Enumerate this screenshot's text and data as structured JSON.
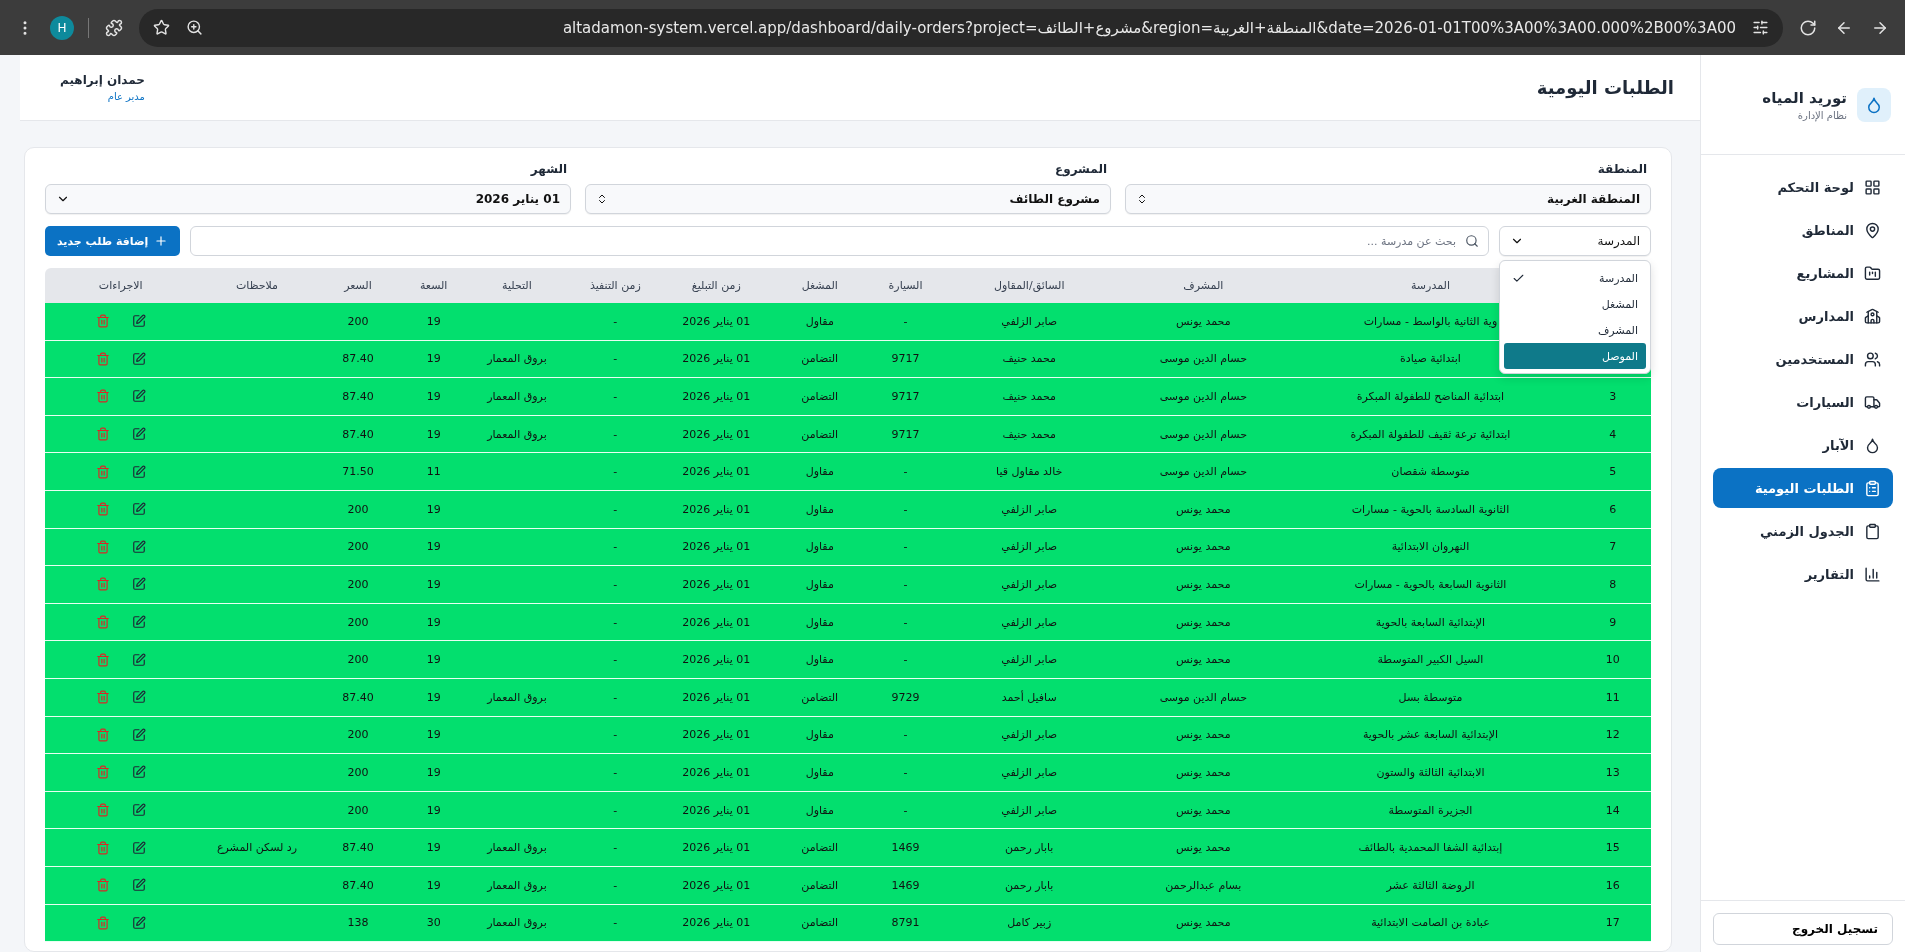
{
  "browser": {
    "profile_initial": "H",
    "url": "altadamon-system.vercel.app/dashboard/daily-orders?project=مشروع+الطائف&region=المنطقة+الغربية&date=2026-01-01T00%3A00%3A00.000%2B00%3A00"
  },
  "header": {
    "title": "الطلبات اليومية",
    "user_name": "حمدان إبراهيم",
    "user_role": "مدير عام"
  },
  "sidebar": {
    "brand": "توريد المياه",
    "subtitle": "نظام الإدارة",
    "items": [
      {
        "label": "لوحة التحكم",
        "selected": false
      },
      {
        "label": "المناطق",
        "selected": false
      },
      {
        "label": "المشاريع",
        "selected": false
      },
      {
        "label": "المدارس",
        "selected": false
      },
      {
        "label": "المستخدمين",
        "selected": false
      },
      {
        "label": "السيارات",
        "selected": false
      },
      {
        "label": "الآبار",
        "selected": false
      },
      {
        "label": "الطلبات اليومية",
        "selected": true
      },
      {
        "label": "الجدول الزمني",
        "selected": false
      },
      {
        "label": "التقارير",
        "selected": false
      }
    ],
    "logout": "تسجيل الخروج"
  },
  "filters": [
    {
      "label": "المنطقة",
      "value": "المنطقة الغربية",
      "kind": "updown"
    },
    {
      "label": "المشروع",
      "value": "مشروع الطائف",
      "kind": "updown"
    },
    {
      "label": "الشهر",
      "value": "01 يناير 2026",
      "kind": "down"
    }
  ],
  "search_by": {
    "value": "المدرسة",
    "options": [
      {
        "label": "المدرسة",
        "selected": true,
        "highlighted": false
      },
      {
        "label": "المشغل",
        "selected": false,
        "highlighted": false
      },
      {
        "label": "المشرف",
        "selected": false,
        "highlighted": false
      },
      {
        "label": "الموصل",
        "selected": false,
        "highlighted": true
      }
    ]
  },
  "search": {
    "placeholder": "بحث عن مدرسة ..."
  },
  "add_button": "إضافة طلب جديد",
  "table": {
    "columns": [
      "المدرسة",
      "المشرف",
      "السائق/المقاول",
      "السيارة",
      "المشغل",
      "زمن التبليغ",
      "زمن التنفيذ",
      "التحلية",
      "السعة",
      "السعر",
      "ملاحظات",
      "الاجراءات"
    ],
    "rows": [
      {
        "school": "وية الثانية بالواسط - مسارات",
        "supervisor": "محمد يونس",
        "driver": "صابر الزلفي",
        "car": "-",
        "operator": "مقاول",
        "reported": "01 يناير 2026",
        "executed": "-",
        "capacity": "19",
        "price": "200"
      },
      {
        "school": "ابتدائية صيادة",
        "supervisor": "حسام الدين موسى",
        "driver": "محمد حنيف",
        "car": "9717",
        "operator": "التضامن",
        "reported": "01 يناير 2026",
        "executed": "-",
        "desalination": "بروق المعمار",
        "capacity": "19",
        "price": "87.40"
      },
      {
        "num": "3",
        "school": "ابتدائية المناضح للطفولة المبكرة",
        "supervisor": "حسام الدين موسى",
        "driver": "محمد حنيف",
        "car": "9717",
        "operator": "التضامن",
        "reported": "01 يناير 2026",
        "executed": "-",
        "desalination": "بروق المعمار",
        "capacity": "19",
        "price": "87.40"
      },
      {
        "num": "4",
        "school": "ابتدائية ترعة ثقيف للطفولة المبكرة",
        "supervisor": "حسام الدين موسى",
        "driver": "محمد حنيف",
        "car": "9717",
        "operator": "التضامن",
        "reported": "01 يناير 2026",
        "executed": "-",
        "desalination": "بروق المعمار",
        "capacity": "19",
        "price": "87.40"
      },
      {
        "num": "5",
        "school": "متوسطة شقصان",
        "supervisor": "حسام الدين موسى",
        "driver": "خالد مقاول قيا",
        "car": "-",
        "operator": "مقاول",
        "reported": "01 يناير 2026",
        "executed": "-",
        "capacity": "11",
        "price": "71.50"
      },
      {
        "num": "6",
        "school": "الثانوية السادسة بالحوية - مسارات",
        "supervisor": "محمد يونس",
        "driver": "صابر الزلفي",
        "car": "-",
        "operator": "مقاول",
        "reported": "01 يناير 2026",
        "executed": "-",
        "capacity": "19",
        "price": "200"
      },
      {
        "num": "7",
        "school": "النهروان الابتدائية",
        "supervisor": "محمد يونس",
        "driver": "صابر الزلفي",
        "car": "-",
        "operator": "مقاول",
        "reported": "01 يناير 2026",
        "executed": "-",
        "capacity": "19",
        "price": "200"
      },
      {
        "num": "8",
        "school": "الثانوية السابعة بالحوية - مسارات",
        "supervisor": "محمد يونس",
        "driver": "صابر الزلفي",
        "car": "-",
        "operator": "مقاول",
        "reported": "01 يناير 2026",
        "executed": "-",
        "capacity": "19",
        "price": "200"
      },
      {
        "num": "9",
        "school": "الإبتدائية السابعة بالحوية",
        "supervisor": "محمد يونس",
        "driver": "صابر الزلفي",
        "car": "-",
        "operator": "مقاول",
        "reported": "01 يناير 2026",
        "executed": "-",
        "capacity": "19",
        "price": "200"
      },
      {
        "num": "10",
        "school": "السيل الكبير المتوسطة",
        "supervisor": "محمد يونس",
        "driver": "صابر الزلفي",
        "car": "-",
        "operator": "مقاول",
        "reported": "01 يناير 2026",
        "executed": "-",
        "capacity": "19",
        "price": "200"
      },
      {
        "num": "11",
        "school": "متوسطة بسل",
        "supervisor": "حسام الدين موسى",
        "driver": "سافيل أحمد",
        "car": "9729",
        "operator": "التضامن",
        "reported": "01 يناير 2026",
        "executed": "-",
        "desalination": "بروق المعمار",
        "capacity": "19",
        "price": "87.40"
      },
      {
        "num": "12",
        "school": "الإبتدائية السابعة عشر بالحوية",
        "supervisor": "محمد يونس",
        "driver": "صابر الزلفي",
        "car": "-",
        "operator": "مقاول",
        "reported": "01 يناير 2026",
        "executed": "-",
        "capacity": "19",
        "price": "200"
      },
      {
        "num": "13",
        "school": "الابتدائية الثالثة والستون",
        "supervisor": "محمد يونس",
        "driver": "صابر الزلفي",
        "car": "-",
        "operator": "مقاول",
        "reported": "01 يناير 2026",
        "executed": "-",
        "capacity": "19",
        "price": "200"
      },
      {
        "num": "14",
        "school": "الجزيرة المتوسطة",
        "supervisor": "محمد يونس",
        "driver": "صابر الزلفي",
        "car": "-",
        "operator": "مقاول",
        "reported": "01 يناير 2026",
        "executed": "-",
        "capacity": "19",
        "price": "200"
      },
      {
        "num": "15",
        "school": "إبتدائية الشفا المحمدية بالطائف",
        "supervisor": "محمد يونس",
        "driver": "بابار رحمن",
        "car": "1469",
        "operator": "التضامن",
        "reported": "01 يناير 2026",
        "executed": "-",
        "desalination": "بروق المعمار",
        "capacity": "19",
        "price": "87.40",
        "notes": "رد لسكن المشرع"
      },
      {
        "num": "16",
        "school": "الروضة الثالثة عشر",
        "supervisor": "بسام عبدالرحمن",
        "driver": "بابار رحمن",
        "car": "1469",
        "operator": "التضامن",
        "reported": "01 يناير 2026",
        "executed": "-",
        "desalination": "بروق المعمار",
        "capacity": "19",
        "price": "87.40"
      },
      {
        "num": "17",
        "school": "عبادة بن الصامت الابتدائية",
        "supervisor": "محمد يونس",
        "driver": "زبير كامل",
        "car": "8791",
        "operator": "التضامن",
        "reported": "01 يناير 2026",
        "executed": "-",
        "desalination": "بروق المعمار",
        "capacity": "30",
        "price": "138"
      }
    ]
  }
}
